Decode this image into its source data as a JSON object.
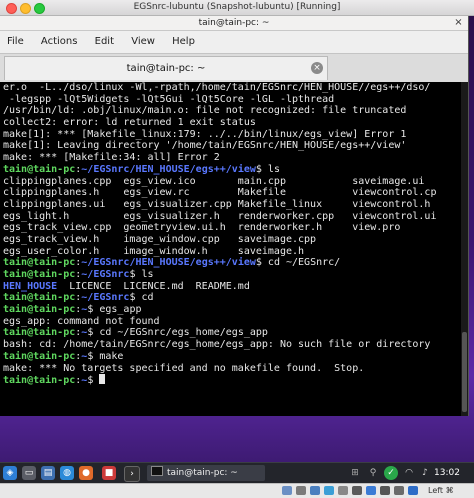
{
  "vm_window": {
    "title": "EGSnrc-lubuntu (Snapshot-lubuntu) [Running]"
  },
  "terminal": {
    "window_title": "tain@tain-pc: ~",
    "close_glyph": "×",
    "menu": [
      "File",
      "Actions",
      "Edit",
      "View",
      "Help"
    ],
    "tab": {
      "title": "tain@tain-pc: ~",
      "close_glyph": "×"
    },
    "lines": [
      [
        {
          "t": "er.o  -L../dso/linux -Wl,-rpath,/home/tain/EGSnrc/HEN_HOUSE//egs++/dso/",
          "c": "w"
        }
      ],
      [
        {
          "t": " -legspp -lQt5Widgets -lQt5Gui -lQt5Core -lGL -lpthread",
          "c": "w"
        }
      ],
      [
        {
          "t": "/usr/bin/ld: .obj/linux/main.o: file not recognized: file truncated",
          "c": "w"
        }
      ],
      [
        {
          "t": "collect2: error: ld returned 1 exit status",
          "c": "w"
        }
      ],
      [
        {
          "t": "make[1]: *** [Makefile_linux:179: ../../bin/linux/egs_view] Error 1",
          "c": "w"
        }
      ],
      [
        {
          "t": "make[1]: Leaving directory '/home/tain/EGSnrc/HEN_HOUSE/egs++/view'",
          "c": "w"
        }
      ],
      [
        {
          "t": "make: *** [Makefile:34: all] Error 2",
          "c": "w"
        }
      ],
      [
        {
          "t": "tain@tain-pc",
          "c": "g"
        },
        {
          "t": ":",
          "c": "w"
        },
        {
          "t": "~/EGSnrc/HEN_HOUSE/egs++/view",
          "c": "b"
        },
        {
          "t": "$ ls",
          "c": "w"
        }
      ],
      [
        {
          "t": "clippingplanes.cpp  egs_view.ico       main.cpp           saveimage.ui",
          "c": "w"
        }
      ],
      [
        {
          "t": "clippingplanes.h    egs_view.rc        Makefile           viewcontrol.cp",
          "c": "w"
        }
      ],
      [
        {
          "t": "clippingplanes.ui   egs_visualizer.cpp Makefile_linux     viewcontrol.h",
          "c": "w"
        }
      ],
      [
        {
          "t": "egs_light.h         egs_visualizer.h   renderworker.cpp   viewcontrol.ui",
          "c": "w"
        }
      ],
      [
        {
          "t": "egs_track_view.cpp  geometryview.ui.h  renderworker.h     view.pro",
          "c": "w"
        }
      ],
      [
        {
          "t": "egs_track_view.h    image_window.cpp   saveimage.cpp",
          "c": "w"
        }
      ],
      [
        {
          "t": "egs_user_color.h    image_window.h     saveimage.h",
          "c": "w"
        }
      ],
      [
        {
          "t": "tain@tain-pc",
          "c": "g"
        },
        {
          "t": ":",
          "c": "w"
        },
        {
          "t": "~/EGSnrc/HEN_HOUSE/egs++/view",
          "c": "b"
        },
        {
          "t": "$ cd ~/EGSnrc/",
          "c": "w"
        }
      ],
      [
        {
          "t": "tain@tain-pc",
          "c": "g"
        },
        {
          "t": ":",
          "c": "w"
        },
        {
          "t": "~/EGSnrc",
          "c": "b"
        },
        {
          "t": "$ ls",
          "c": "w"
        }
      ],
      [
        {
          "t": "HEN_HOUSE",
          "c": "b"
        },
        {
          "t": "  LICENCE  LICENCE.md  README.md",
          "c": "w"
        }
      ],
      [
        {
          "t": "tain@tain-pc",
          "c": "g"
        },
        {
          "t": ":",
          "c": "w"
        },
        {
          "t": "~/EGSnrc",
          "c": "b"
        },
        {
          "t": "$ cd",
          "c": "w"
        }
      ],
      [
        {
          "t": "tain@tain-pc",
          "c": "g"
        },
        {
          "t": ":",
          "c": "w"
        },
        {
          "t": "~",
          "c": "b"
        },
        {
          "t": "$ egs_app",
          "c": "w"
        }
      ],
      [
        {
          "t": "egs_app: command not found",
          "c": "w"
        }
      ],
      [
        {
          "t": "tain@tain-pc",
          "c": "g"
        },
        {
          "t": ":",
          "c": "w"
        },
        {
          "t": "~",
          "c": "b"
        },
        {
          "t": "$ cd ~/EGSnrc/egs_home/egs_app",
          "c": "w"
        }
      ],
      [
        {
          "t": "bash: cd: /home/tain/EGSnrc/egs_home/egs_app: No such file or directory",
          "c": "w"
        }
      ],
      [
        {
          "t": "tain@tain-pc",
          "c": "g"
        },
        {
          "t": ":",
          "c": "w"
        },
        {
          "t": "~",
          "c": "b"
        },
        {
          "t": "$ make",
          "c": "w"
        }
      ],
      [
        {
          "t": "make: *** No targets specified and no makefile found.  Stop.",
          "c": "w"
        }
      ],
      [
        {
          "t": "tain@tain-pc",
          "c": "g"
        },
        {
          "t": ":",
          "c": "w"
        },
        {
          "t": "~",
          "c": "b"
        },
        {
          "t": "$ ",
          "c": "w"
        }
      ]
    ]
  },
  "taskbar": {
    "task_label": "tain@tain-pc: ~",
    "clock": "13:02",
    "icons": [
      "lubuntu-menu-icon",
      "file-manager-icon",
      "firefox-icon",
      "terminal-icon",
      "updates-icon",
      "volume-icon",
      "network-icon"
    ]
  },
  "vbox_status": {
    "host_key": "Left ⌘"
  }
}
